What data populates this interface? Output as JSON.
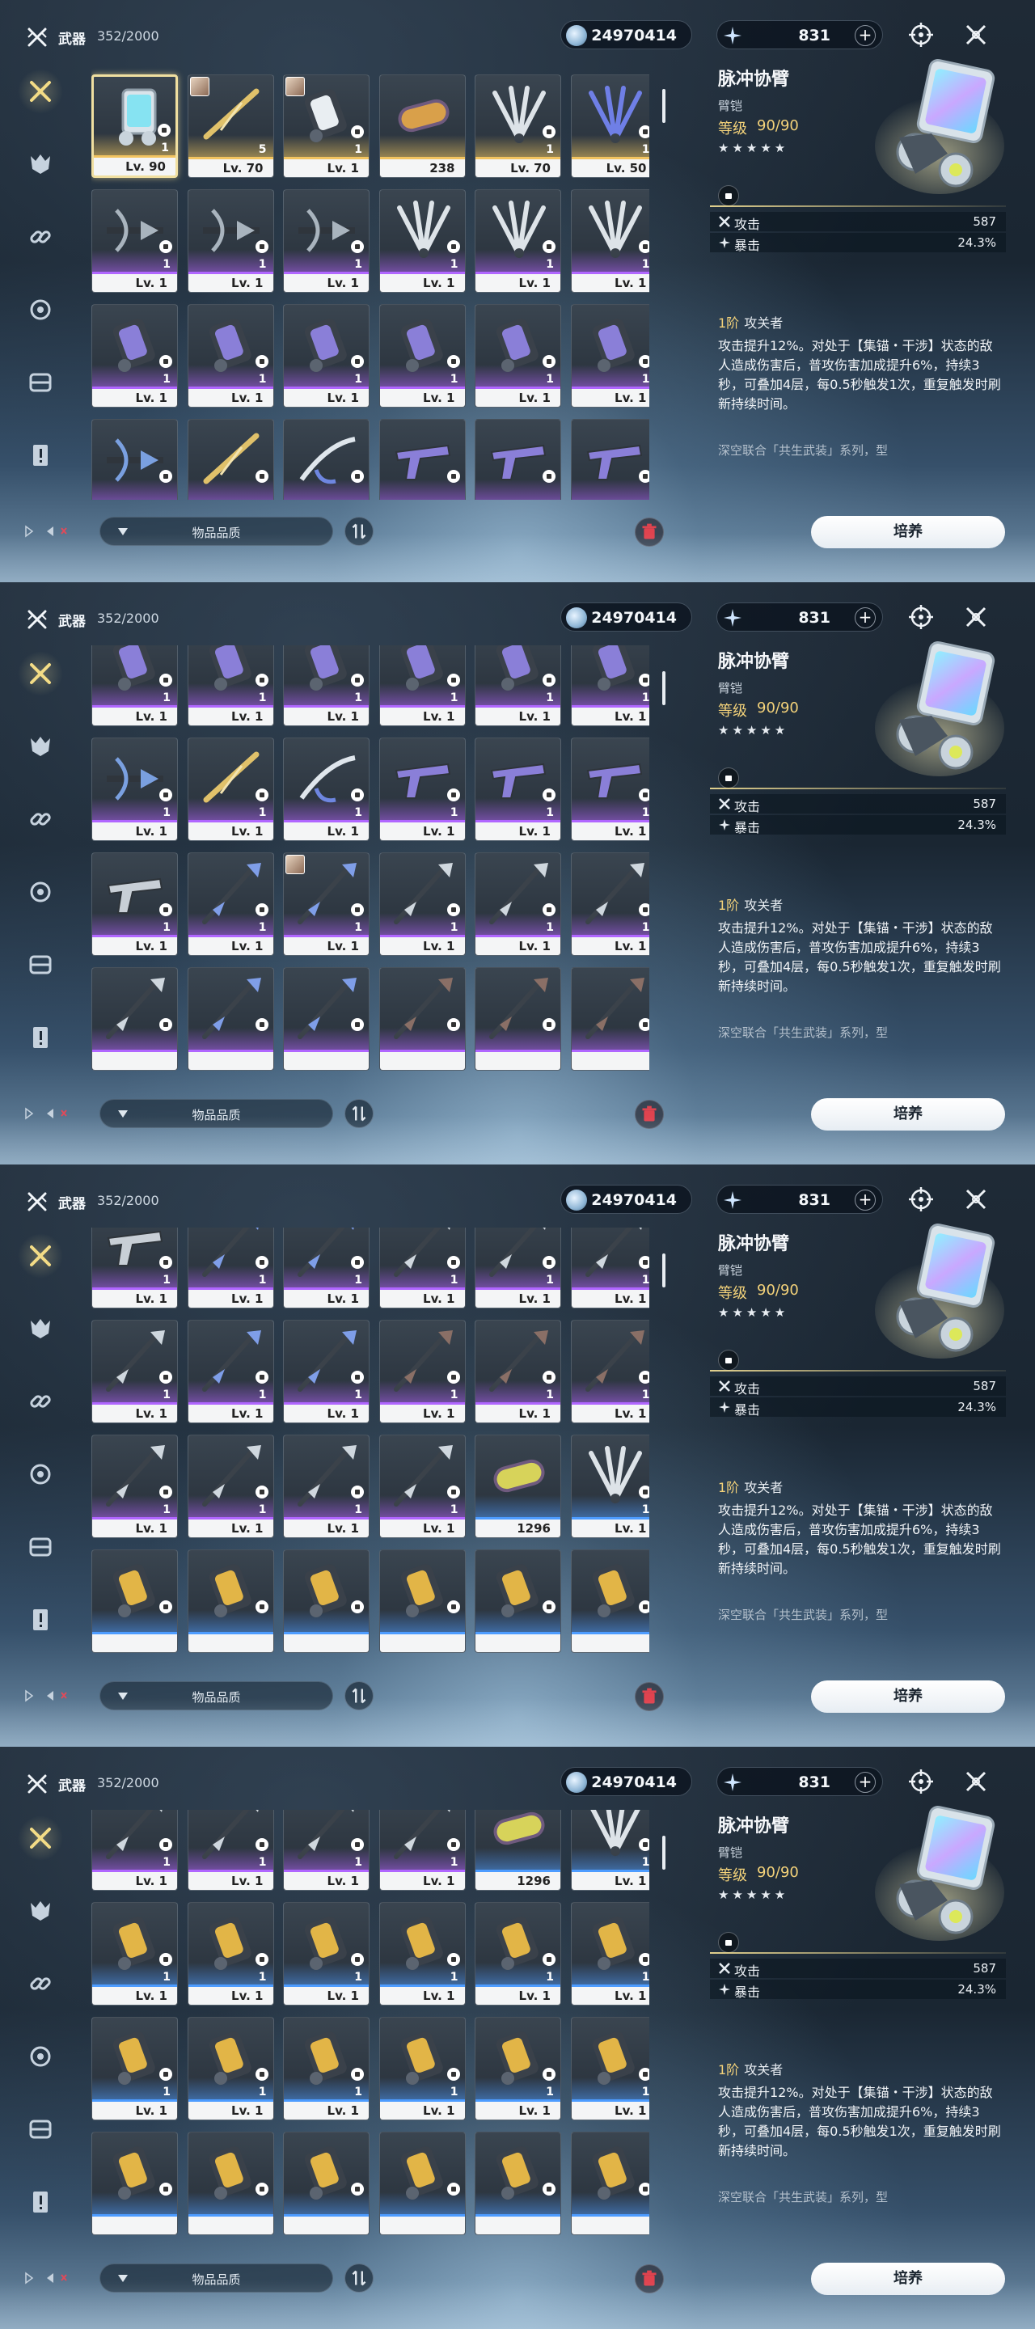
{
  "header": {
    "title": "武器",
    "count": "352/2000",
    "currency1": "24970414",
    "currency2": "831",
    "plus": "+"
  },
  "detail": {
    "name": "脉冲协臂",
    "type": "臂铠",
    "level_label": "等级",
    "level_value": "90/90",
    "stars": "★★★★★",
    "stats": [
      {
        "name": "攻击",
        "value": "587"
      },
      {
        "name": "暴击",
        "value": "24.3%"
      }
    ],
    "skill_tier": "1阶",
    "skill_name": "攻关者",
    "skill_desc": "攻击提升12%。对处于【集锚・干涉】状态的敌人造成伤害后，普攻伤害加成提升6%，持续3秒，可叠加4层，每0.5秒触发1次，重复触发时刷新持续时间。",
    "series": "深空联合「共生武装」系列，型"
  },
  "bottom": {
    "sort_label": "物品品质",
    "cultivate_label": "培养"
  },
  "panels": [
    {
      "cards": [
        {
          "level": "Lv. 90",
          "count": "1",
          "rarity": "gold",
          "weapon": "armguard-teal",
          "lock": true,
          "selected": true
        },
        {
          "level": "Lv. 70",
          "count": "5",
          "rarity": "gold",
          "weapon": "blade-gold",
          "lock": false,
          "avatar": true
        },
        {
          "level": "Lv. 1",
          "count": "1",
          "rarity": "gold",
          "weapon": "gauntlet-white",
          "lock": true,
          "avatar": true
        },
        {
          "level": "238",
          "count": "",
          "rarity": "gold",
          "weapon": "capsule-gold",
          "lock": false
        },
        {
          "level": "Lv. 70",
          "count": "1",
          "rarity": "gold",
          "weapon": "claw-silver",
          "lock": true
        },
        {
          "level": "Lv. 50",
          "count": "1",
          "rarity": "gold",
          "weapon": "claw-blue",
          "lock": true
        },
        {
          "level": "Lv. 1",
          "count": "1",
          "rarity": "purple",
          "weapon": "crossbow-dark",
          "lock": true
        },
        {
          "level": "Lv. 1",
          "count": "1",
          "rarity": "purple",
          "weapon": "crossbow-dark",
          "lock": true
        },
        {
          "level": "Lv. 1",
          "count": "1",
          "rarity": "purple",
          "weapon": "crossbow-dark",
          "lock": true
        },
        {
          "level": "Lv. 1",
          "count": "1",
          "rarity": "purple",
          "weapon": "fan-silver",
          "lock": true
        },
        {
          "level": "Lv. 1",
          "count": "1",
          "rarity": "purple",
          "weapon": "fan-silver",
          "lock": true
        },
        {
          "level": "Lv. 1",
          "count": "1",
          "rarity": "purple",
          "weapon": "fan-silver",
          "lock": true
        },
        {
          "level": "Lv. 1",
          "count": "1",
          "rarity": "purple",
          "weapon": "gauntlet-violet",
          "lock": true
        },
        {
          "level": "Lv. 1",
          "count": "1",
          "rarity": "purple",
          "weapon": "gauntlet-violet",
          "lock": true
        },
        {
          "level": "Lv. 1",
          "count": "1",
          "rarity": "purple",
          "weapon": "gauntlet-violet",
          "lock": true
        },
        {
          "level": "Lv. 1",
          "count": "1",
          "rarity": "purple",
          "weapon": "gauntlet-violet",
          "lock": true
        },
        {
          "level": "Lv. 1",
          "count": "1",
          "rarity": "purple",
          "weapon": "gauntlet-violet",
          "lock": true
        },
        {
          "level": "Lv. 1",
          "count": "1",
          "rarity": "purple",
          "weapon": "gauntlet-violet",
          "lock": true
        },
        {
          "level": "",
          "count": "",
          "rarity": "purple",
          "weapon": "crossbow-blue",
          "lock": true
        },
        {
          "level": "",
          "count": "",
          "rarity": "purple",
          "weapon": "blade-gold",
          "lock": true
        },
        {
          "level": "",
          "count": "",
          "rarity": "purple",
          "weapon": "hook-silver",
          "lock": true
        },
        {
          "level": "",
          "count": "",
          "rarity": "purple",
          "weapon": "pistol-violet",
          "lock": true
        },
        {
          "level": "",
          "count": "",
          "rarity": "purple",
          "weapon": "pistol-violet",
          "lock": true
        },
        {
          "level": "",
          "count": "",
          "rarity": "purple",
          "weapon": "pistol-violet",
          "lock": true
        }
      ]
    },
    {
      "cards": [
        {
          "level": "Lv. 1",
          "count": "1",
          "rarity": "purple",
          "weapon": "gauntlet-violet",
          "lock": true
        },
        {
          "level": "Lv. 1",
          "count": "1",
          "rarity": "purple",
          "weapon": "gauntlet-violet",
          "lock": true
        },
        {
          "level": "Lv. 1",
          "count": "1",
          "rarity": "purple",
          "weapon": "gauntlet-violet",
          "lock": true
        },
        {
          "level": "Lv. 1",
          "count": "1",
          "rarity": "purple",
          "weapon": "gauntlet-violet",
          "lock": true
        },
        {
          "level": "Lv. 1",
          "count": "1",
          "rarity": "purple",
          "weapon": "gauntlet-violet",
          "lock": true
        },
        {
          "level": "Lv. 1",
          "count": "1",
          "rarity": "purple",
          "weapon": "gauntlet-violet",
          "lock": true
        },
        {
          "level": "Lv. 1",
          "count": "1",
          "rarity": "purple",
          "weapon": "crossbow-blue",
          "lock": true
        },
        {
          "level": "Lv. 1",
          "count": "1",
          "rarity": "purple",
          "weapon": "blade-gold",
          "lock": true
        },
        {
          "level": "Lv. 1",
          "count": "1",
          "rarity": "purple",
          "weapon": "hook-silver",
          "lock": true
        },
        {
          "level": "Lv. 1",
          "count": "1",
          "rarity": "purple",
          "weapon": "pistol-violet",
          "lock": true
        },
        {
          "level": "Lv. 1",
          "count": "1",
          "rarity": "purple",
          "weapon": "pistol-violet",
          "lock": true
        },
        {
          "level": "Lv. 1",
          "count": "1",
          "rarity": "purple",
          "weapon": "pistol-violet",
          "lock": true
        },
        {
          "level": "Lv. 1",
          "count": "1",
          "rarity": "purple",
          "weapon": "rifle-silver",
          "lock": true
        },
        {
          "level": "Lv. 1",
          "count": "1",
          "rarity": "purple",
          "weapon": "spear-blue",
          "lock": true
        },
        {
          "level": "Lv. 1",
          "count": "1",
          "rarity": "purple",
          "weapon": "spear-blue",
          "lock": true,
          "avatar": true
        },
        {
          "level": "Lv. 1",
          "count": "1",
          "rarity": "purple",
          "weapon": "spear-silver",
          "lock": true
        },
        {
          "level": "Lv. 1",
          "count": "1",
          "rarity": "purple",
          "weapon": "spear-silver",
          "lock": true
        },
        {
          "level": "Lv. 1",
          "count": "1",
          "rarity": "purple",
          "weapon": "spear-silver",
          "lock": true
        },
        {
          "level": "",
          "count": "",
          "rarity": "purple",
          "weapon": "lance-silver",
          "lock": true
        },
        {
          "level": "",
          "count": "",
          "rarity": "purple",
          "weapon": "spear-blue",
          "lock": true
        },
        {
          "level": "",
          "count": "",
          "rarity": "purple",
          "weapon": "spear-blue",
          "lock": true
        },
        {
          "level": "",
          "count": "",
          "rarity": "purple",
          "weapon": "spear-dark",
          "lock": true
        },
        {
          "level": "",
          "count": "",
          "rarity": "purple",
          "weapon": "spear-dark",
          "lock": true
        },
        {
          "level": "",
          "count": "",
          "rarity": "purple",
          "weapon": "spear-dark",
          "lock": true
        }
      ]
    },
    {
      "cards": [
        {
          "level": "Lv. 1",
          "count": "1",
          "rarity": "purple",
          "weapon": "rifle-silver",
          "lock": true
        },
        {
          "level": "Lv. 1",
          "count": "1",
          "rarity": "purple",
          "weapon": "spear-blue",
          "lock": true
        },
        {
          "level": "Lv. 1",
          "count": "1",
          "rarity": "purple",
          "weapon": "spear-blue",
          "lock": true,
          "avatar": true
        },
        {
          "level": "Lv. 1",
          "count": "1",
          "rarity": "purple",
          "weapon": "spear-silver",
          "lock": true
        },
        {
          "level": "Lv. 1",
          "count": "1",
          "rarity": "purple",
          "weapon": "spear-silver",
          "lock": true
        },
        {
          "level": "Lv. 1",
          "count": "1",
          "rarity": "purple",
          "weapon": "spear-silver",
          "lock": true
        },
        {
          "level": "Lv. 1",
          "count": "1",
          "rarity": "purple",
          "weapon": "lance-silver",
          "lock": true
        },
        {
          "level": "Lv. 1",
          "count": "1",
          "rarity": "purple",
          "weapon": "spear-blue",
          "lock": true
        },
        {
          "level": "Lv. 1",
          "count": "1",
          "rarity": "purple",
          "weapon": "spear-blue",
          "lock": true
        },
        {
          "level": "Lv. 1",
          "count": "1",
          "rarity": "purple",
          "weapon": "spear-dark",
          "lock": true
        },
        {
          "level": "Lv. 1",
          "count": "1",
          "rarity": "purple",
          "weapon": "spear-dark",
          "lock": true
        },
        {
          "level": "Lv. 1",
          "count": "1",
          "rarity": "purple",
          "weapon": "spear-dark",
          "lock": true
        },
        {
          "level": "Lv. 1",
          "count": "1",
          "rarity": "purple",
          "weapon": "spear-silver",
          "lock": true
        },
        {
          "level": "Lv. 1",
          "count": "1",
          "rarity": "purple",
          "weapon": "spear-silver",
          "lock": true
        },
        {
          "level": "Lv. 1",
          "count": "1",
          "rarity": "purple",
          "weapon": "spear-silver",
          "lock": true
        },
        {
          "level": "Lv. 1",
          "count": "1",
          "rarity": "purple",
          "weapon": "spear-silver",
          "lock": true
        },
        {
          "level": "1296",
          "count": "",
          "rarity": "blue",
          "weapon": "capsule-violet",
          "lock": false
        },
        {
          "level": "Lv. 1",
          "count": "1",
          "rarity": "blue",
          "weapon": "fan-silver",
          "lock": true
        },
        {
          "level": "",
          "count": "",
          "rarity": "blue",
          "weapon": "gauntlet-gold",
          "lock": true
        },
        {
          "level": "",
          "count": "",
          "rarity": "blue",
          "weapon": "gauntlet-gold",
          "lock": true
        },
        {
          "level": "",
          "count": "",
          "rarity": "blue",
          "weapon": "gauntlet-gold",
          "lock": true
        },
        {
          "level": "",
          "count": "",
          "rarity": "blue",
          "weapon": "gauntlet-gold",
          "lock": true
        },
        {
          "level": "",
          "count": "",
          "rarity": "blue",
          "weapon": "gauntlet-gold",
          "lock": true
        },
        {
          "level": "",
          "count": "",
          "rarity": "blue",
          "weapon": "gauntlet-gold",
          "lock": true
        }
      ]
    },
    {
      "cards": [
        {
          "level": "Lv. 1",
          "count": "1",
          "rarity": "purple",
          "weapon": "spear-silver",
          "lock": true
        },
        {
          "level": "Lv. 1",
          "count": "1",
          "rarity": "purple",
          "weapon": "spear-silver",
          "lock": true
        },
        {
          "level": "Lv. 1",
          "count": "1",
          "rarity": "purple",
          "weapon": "spear-silver",
          "lock": true
        },
        {
          "level": "Lv. 1",
          "count": "1",
          "rarity": "purple",
          "weapon": "spear-silver",
          "lock": true
        },
        {
          "level": "1296",
          "count": "",
          "rarity": "blue",
          "weapon": "capsule-violet",
          "lock": false
        },
        {
          "level": "Lv. 1",
          "count": "1",
          "rarity": "blue",
          "weapon": "fan-silver",
          "lock": true
        },
        {
          "level": "Lv. 1",
          "count": "1",
          "rarity": "blue",
          "weapon": "gauntlet-gold",
          "lock": true
        },
        {
          "level": "Lv. 1",
          "count": "1",
          "rarity": "blue",
          "weapon": "gauntlet-gold",
          "lock": true
        },
        {
          "level": "Lv. 1",
          "count": "1",
          "rarity": "blue",
          "weapon": "gauntlet-gold",
          "lock": true
        },
        {
          "level": "Lv. 1",
          "count": "1",
          "rarity": "blue",
          "weapon": "gauntlet-gold",
          "lock": true
        },
        {
          "level": "Lv. 1",
          "count": "1",
          "rarity": "blue",
          "weapon": "gauntlet-gold",
          "lock": true
        },
        {
          "level": "Lv. 1",
          "count": "1",
          "rarity": "blue",
          "weapon": "gauntlet-gold",
          "lock": true
        },
        {
          "level": "Lv. 1",
          "count": "1",
          "rarity": "blue",
          "weapon": "gauntlet-gold",
          "lock": true
        },
        {
          "level": "Lv. 1",
          "count": "1",
          "rarity": "blue",
          "weapon": "gauntlet-gold",
          "lock": true
        },
        {
          "level": "Lv. 1",
          "count": "1",
          "rarity": "blue",
          "weapon": "gauntlet-gold",
          "lock": true
        },
        {
          "level": "Lv. 1",
          "count": "1",
          "rarity": "blue",
          "weapon": "gauntlet-gold",
          "lock": true
        },
        {
          "level": "Lv. 1",
          "count": "1",
          "rarity": "blue",
          "weapon": "gauntlet-gold",
          "lock": true
        },
        {
          "level": "Lv. 1",
          "count": "1",
          "rarity": "blue",
          "weapon": "gauntlet-gold",
          "lock": true
        },
        {
          "level": "",
          "count": "",
          "rarity": "blue",
          "weapon": "gauntlet-gold",
          "lock": true
        },
        {
          "level": "",
          "count": "",
          "rarity": "blue",
          "weapon": "gauntlet-gold",
          "lock": true
        },
        {
          "level": "",
          "count": "",
          "rarity": "blue",
          "weapon": "gauntlet-gold",
          "lock": true
        },
        {
          "level": "",
          "count": "",
          "rarity": "blue",
          "weapon": "gauntlet-gold",
          "lock": true
        },
        {
          "level": "",
          "count": "",
          "rarity": "blue",
          "weapon": "gauntlet-gold",
          "lock": true
        },
        {
          "level": "",
          "count": "",
          "rarity": "blue",
          "weapon": "gauntlet-gold",
          "lock": true
        }
      ]
    }
  ],
  "colors": {
    "gold": "#f2c460",
    "purple": "#b066ff",
    "blue": "#4d9cff",
    "accent": "#f3d27a"
  }
}
